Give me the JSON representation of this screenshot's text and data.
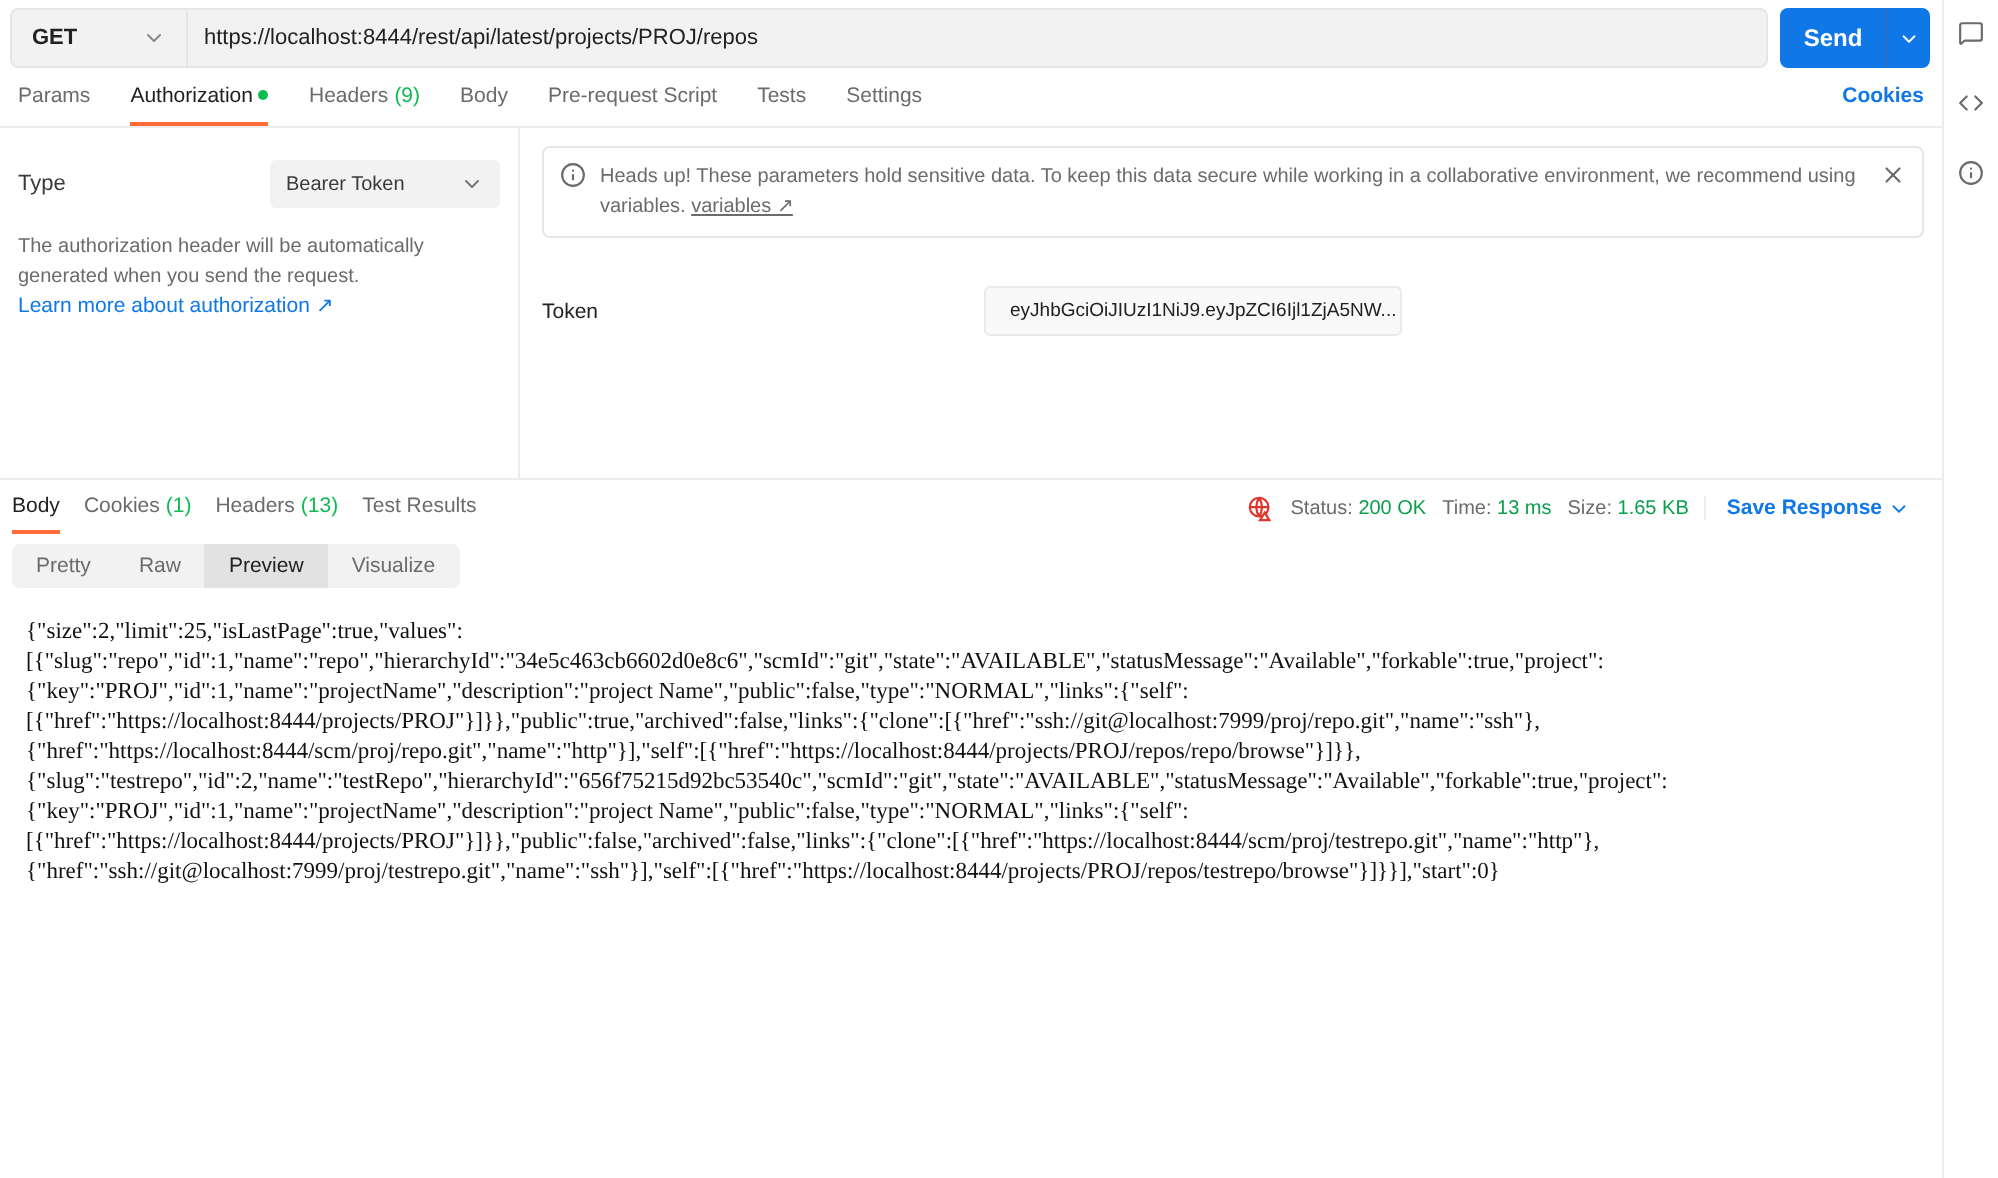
{
  "request": {
    "method": "GET",
    "url": "https://localhost:8444/rest/api/latest/projects/PROJ/repos",
    "send": "Send"
  },
  "request_tabs": [
    {
      "label": "Params",
      "selected": false,
      "dot": false
    },
    {
      "label": "Authorization",
      "selected": true,
      "dot": true
    },
    {
      "label": "Headers",
      "count": "(9)",
      "selected": false,
      "dot": false
    },
    {
      "label": "Body",
      "selected": false,
      "dot": false
    },
    {
      "label": "Pre-request Script",
      "selected": false,
      "dot": false
    },
    {
      "label": "Tests",
      "selected": false,
      "dot": false
    },
    {
      "label": "Settings",
      "selected": false,
      "dot": false
    }
  ],
  "cookies_link": "Cookies",
  "auth": {
    "type_label": "Type",
    "type_value": "Bearer Token",
    "description": "The authorization header will be automatically generated when you send the request.",
    "learn_link": "Learn more about authorization ↗",
    "notice": "Heads up! These parameters hold sensitive data. To keep this data secure while working in a collaborative environment, we recommend using variables.",
    "notice_link": "variables ↗",
    "token_label": "Token",
    "token_value": "eyJhbGciOiJIUzI1NiJ9.eyJpZCI6Ijl1ZjA5NW..."
  },
  "response_tabs": [
    {
      "label": "Body",
      "selected": true
    },
    {
      "label": "Cookies",
      "count": "(1)",
      "selected": false
    },
    {
      "label": "Headers",
      "count": "(13)",
      "selected": false
    },
    {
      "label": "Test Results",
      "selected": false
    }
  ],
  "status": {
    "status_label": "Status:",
    "status_value": "200 OK",
    "time_label": "Time:",
    "time_value": "13 ms",
    "size_label": "Size:",
    "size_value": "1.65 KB",
    "save": "Save Response"
  },
  "view_modes": [
    {
      "label": "Pretty",
      "selected": false
    },
    {
      "label": "Raw",
      "selected": false
    },
    {
      "label": "Preview",
      "selected": true
    },
    {
      "label": "Visualize",
      "selected": false
    }
  ],
  "preview_lines": [
    "{\"size\":2,\"limit\":25,\"isLastPage\":true,\"values\":",
    "[{\"slug\":\"repo\",\"id\":1,\"name\":\"repo\",\"hierarchyId\":\"34e5c463cb6602d0e8c6\",\"scmId\":\"git\",\"state\":\"AVAILABLE\",\"statusMessage\":\"Available\",\"forkable\":true,\"project\":",
    "{\"key\":\"PROJ\",\"id\":1,\"name\":\"projectName\",\"description\":\"project Name\",\"public\":false,\"type\":\"NORMAL\",\"links\":{\"self\":",
    "[{\"href\":\"https://localhost:8444/projects/PROJ\"}]}},\"public\":true,\"archived\":false,\"links\":{\"clone\":[{\"href\":\"ssh://git@localhost:7999/proj/repo.git\",\"name\":\"ssh\"},",
    "{\"href\":\"https://localhost:8444/scm/proj/repo.git\",\"name\":\"http\"}],\"self\":[{\"href\":\"https://localhost:8444/projects/PROJ/repos/repo/browse\"}]}},",
    "{\"slug\":\"testrepo\",\"id\":2,\"name\":\"testRepo\",\"hierarchyId\":\"656f75215d92bc53540c\",\"scmId\":\"git\",\"state\":\"AVAILABLE\",\"statusMessage\":\"Available\",\"forkable\":true,\"project\":",
    "{\"key\":\"PROJ\",\"id\":1,\"name\":\"projectName\",\"description\":\"project Name\",\"public\":false,\"type\":\"NORMAL\",\"links\":{\"self\":",
    "[{\"href\":\"https://localhost:8444/projects/PROJ\"}]}},\"public\":false,\"archived\":false,\"links\":{\"clone\":[{\"href\":\"https://localhost:8444/scm/proj/testrepo.git\",\"name\":\"http\"},",
    "{\"href\":\"ssh://git@localhost:7999/proj/testrepo.git\",\"name\":\"ssh\"}],\"self\":[{\"href\":\"https://localhost:8444/projects/PROJ/repos/testrepo/browse\"}]}}],\"start\":0}"
  ]
}
